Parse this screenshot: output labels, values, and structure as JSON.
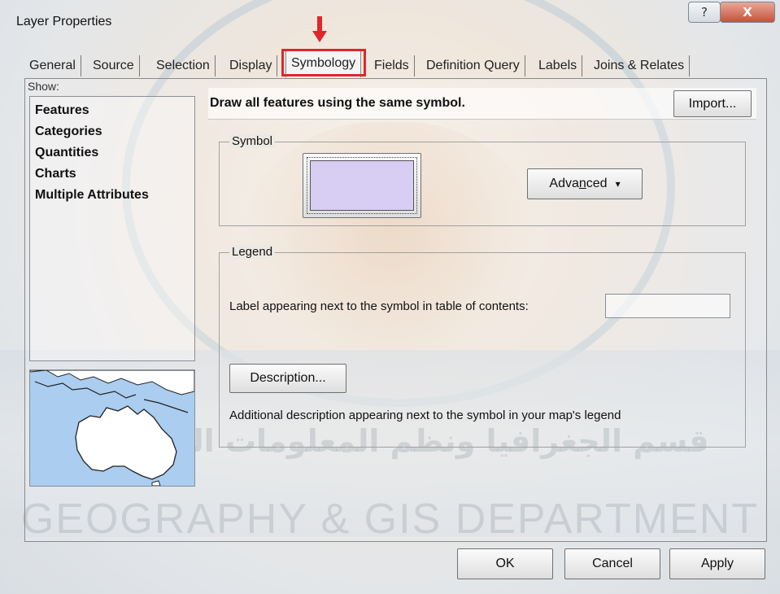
{
  "window": {
    "title": "Layer Properties",
    "help_glyph": "?",
    "close_glyph": "X"
  },
  "tabs": [
    {
      "label": "General"
    },
    {
      "label": "Source"
    },
    {
      "label": "Selection"
    },
    {
      "label": "Display"
    },
    {
      "label": "Symbology",
      "active": true
    },
    {
      "label": "Fields"
    },
    {
      "label": "Definition Query"
    },
    {
      "label": "Labels"
    },
    {
      "label": "Joins & Relates"
    }
  ],
  "show": {
    "label": "Show:",
    "items": [
      "Features",
      "Categories",
      "Quantities",
      "Charts",
      "Multiple Attributes"
    ]
  },
  "main": {
    "header_text": "Draw all features using the same symbol.",
    "import_label": "Import...",
    "symbol_group_label": "Symbol",
    "symbol_color": "#d8cdf3",
    "advanced_label_pre": "Adva",
    "advanced_label_mnemonic": "n",
    "advanced_label_post": "ced",
    "advanced_dropdown_glyph": "▾",
    "legend_group_label": "Legend",
    "legend_label_text": "Label appearing next to the symbol in table of contents:",
    "legend_label_value": "",
    "description_button": "Description...",
    "description_text": "Additional description appearing next to the symbol in your map's legend"
  },
  "footer": {
    "ok": "OK",
    "cancel": "Cancel",
    "apply": "Apply"
  },
  "watermark": {
    "arabic": "قسم الجغرافيا ونظم المعلومات الجغرافية",
    "english": "GEOGRAPHY & GIS DEPARTMENT"
  },
  "colors": {
    "highlight": "#e0262b",
    "map_water": "#aacdf0",
    "map_land": "#ffffff"
  }
}
